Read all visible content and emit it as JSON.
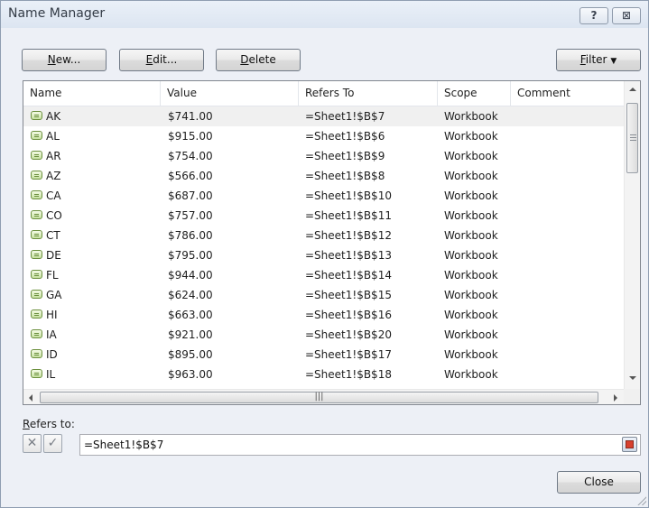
{
  "window": {
    "title": "Name Manager"
  },
  "toolbar": {
    "new": {
      "u": "N",
      "rest": "ew..."
    },
    "edit": {
      "u": "E",
      "rest": "dit..."
    },
    "delete": {
      "u": "D",
      "rest": "elete"
    },
    "filter": {
      "u": "F",
      "rest": "ilter"
    }
  },
  "columns": [
    "Name",
    "Value",
    "Refers To",
    "Scope",
    "Comment"
  ],
  "rows": [
    {
      "name": "AK",
      "value": "$741.00",
      "refers": "=Sheet1!$B$7",
      "scope": "Workbook",
      "comment": ""
    },
    {
      "name": "AL",
      "value": "$915.00",
      "refers": "=Sheet1!$B$6",
      "scope": "Workbook",
      "comment": ""
    },
    {
      "name": "AR",
      "value": "$754.00",
      "refers": "=Sheet1!$B$9",
      "scope": "Workbook",
      "comment": ""
    },
    {
      "name": "AZ",
      "value": "$566.00",
      "refers": "=Sheet1!$B$8",
      "scope": "Workbook",
      "comment": ""
    },
    {
      "name": "CA",
      "value": "$687.00",
      "refers": "=Sheet1!$B$10",
      "scope": "Workbook",
      "comment": ""
    },
    {
      "name": "CO",
      "value": "$757.00",
      "refers": "=Sheet1!$B$11",
      "scope": "Workbook",
      "comment": ""
    },
    {
      "name": "CT",
      "value": "$786.00",
      "refers": "=Sheet1!$B$12",
      "scope": "Workbook",
      "comment": ""
    },
    {
      "name": "DE",
      "value": "$795.00",
      "refers": "=Sheet1!$B$13",
      "scope": "Workbook",
      "comment": ""
    },
    {
      "name": "FL",
      "value": "$944.00",
      "refers": "=Sheet1!$B$14",
      "scope": "Workbook",
      "comment": ""
    },
    {
      "name": "GA",
      "value": "$624.00",
      "refers": "=Sheet1!$B$15",
      "scope": "Workbook",
      "comment": ""
    },
    {
      "name": "HI",
      "value": "$663.00",
      "refers": "=Sheet1!$B$16",
      "scope": "Workbook",
      "comment": ""
    },
    {
      "name": "IA",
      "value": "$921.00",
      "refers": "=Sheet1!$B$20",
      "scope": "Workbook",
      "comment": ""
    },
    {
      "name": "ID",
      "value": "$895.00",
      "refers": "=Sheet1!$B$17",
      "scope": "Workbook",
      "comment": ""
    },
    {
      "name": "IL",
      "value": "$963.00",
      "refers": "=Sheet1!$B$18",
      "scope": "Workbook",
      "comment": ""
    }
  ],
  "refers": {
    "label_u": "R",
    "label_rest": "efers to:",
    "value": "=Sheet1!$B$7"
  },
  "close_label": "Close",
  "icons": {
    "help": "help-icon",
    "close": "close-icon",
    "name": "name-range-icon",
    "cancel": "cancel-x-icon",
    "confirm": "checkmark-icon",
    "collapse": "collapse-dialog-icon"
  },
  "colors": {
    "selected_row": "#f0f0f0",
    "dialog_bg": "#edf0f6",
    "border": "#8f9eb1"
  }
}
